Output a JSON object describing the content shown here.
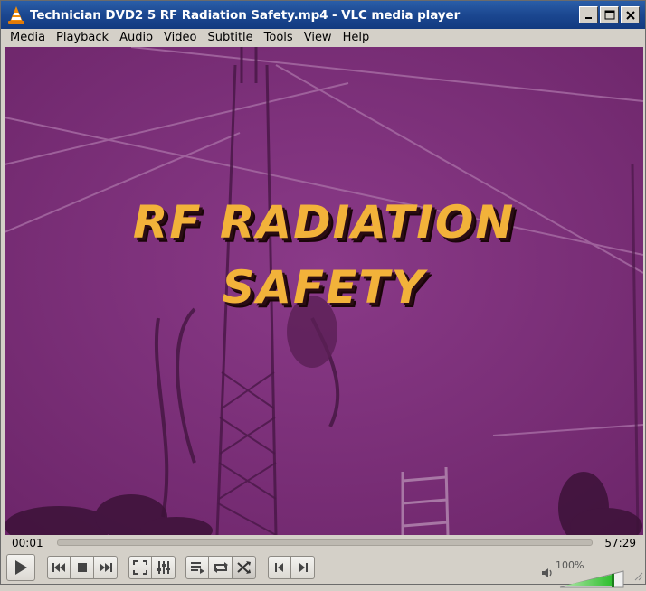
{
  "window": {
    "title": "Technician DVD2 5 RF Radiation Safety.mp4 - VLC media player",
    "buttons": [
      "minimize",
      "maximize",
      "close"
    ]
  },
  "menubar": {
    "items": [
      {
        "label": "Media",
        "mnemonic": "M",
        "rest": "edia"
      },
      {
        "label": "Playback",
        "mnemonic": "P",
        "rest": "layback"
      },
      {
        "label": "Audio",
        "mnemonic": "A",
        "rest": "udio"
      },
      {
        "label": "Video",
        "mnemonic": "V",
        "rest": "ideo"
      },
      {
        "label": "Subtitle",
        "pre": "Sub",
        "mnemonic": "t",
        "rest": "itle"
      },
      {
        "label": "Tools",
        "pre": "Too",
        "mnemonic": "l",
        "rest": "s"
      },
      {
        "label": "View",
        "pre": "V",
        "mnemonic": "i",
        "rest": "ew"
      },
      {
        "label": "Help",
        "mnemonic": "H",
        "rest": "elp"
      }
    ]
  },
  "video": {
    "title_line1": "RF RADIATION",
    "title_line2": "SAFETY",
    "tint_color": "#7a2e7a",
    "title_color": "#f2b23a"
  },
  "playback": {
    "elapsed": "00:01",
    "total": "57:29",
    "progress_fraction": 0.0003
  },
  "volume": {
    "label": "100%",
    "level_fraction": 1.0,
    "fill_color": "#3cc43c"
  },
  "controls": {
    "icons": [
      "play-icon",
      "previous-icon",
      "stop-icon",
      "next-icon",
      "fullscreen-icon",
      "extended-settings-icon",
      "playlist-icon",
      "loop-icon",
      "shuffle-icon",
      "frame-back-icon",
      "frame-next-icon"
    ]
  }
}
